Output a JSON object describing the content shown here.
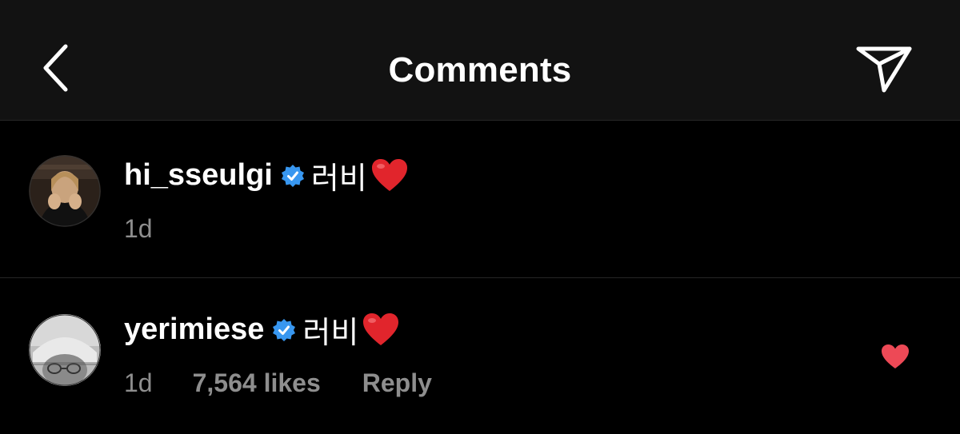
{
  "header": {
    "title": "Comments",
    "back_icon": "chevron-left-icon",
    "share_icon": "send-icon"
  },
  "comments": [
    {
      "username": "hi_sseulgi",
      "verified": true,
      "text": "러비",
      "emoji": "red-heart",
      "time": "1d"
    },
    {
      "username": "yerimiese",
      "verified": true,
      "text": "러비",
      "emoji": "red-heart",
      "time": "1d",
      "likes": "7,564 likes",
      "reply": "Reply",
      "liked": true
    }
  ],
  "colors": {
    "background": "#000000",
    "header_bg": "#121212",
    "divider": "#262626",
    "muted_text": "#8e8e8e",
    "verified_blue": "#3897f0",
    "heart_red": "#ed4956"
  }
}
